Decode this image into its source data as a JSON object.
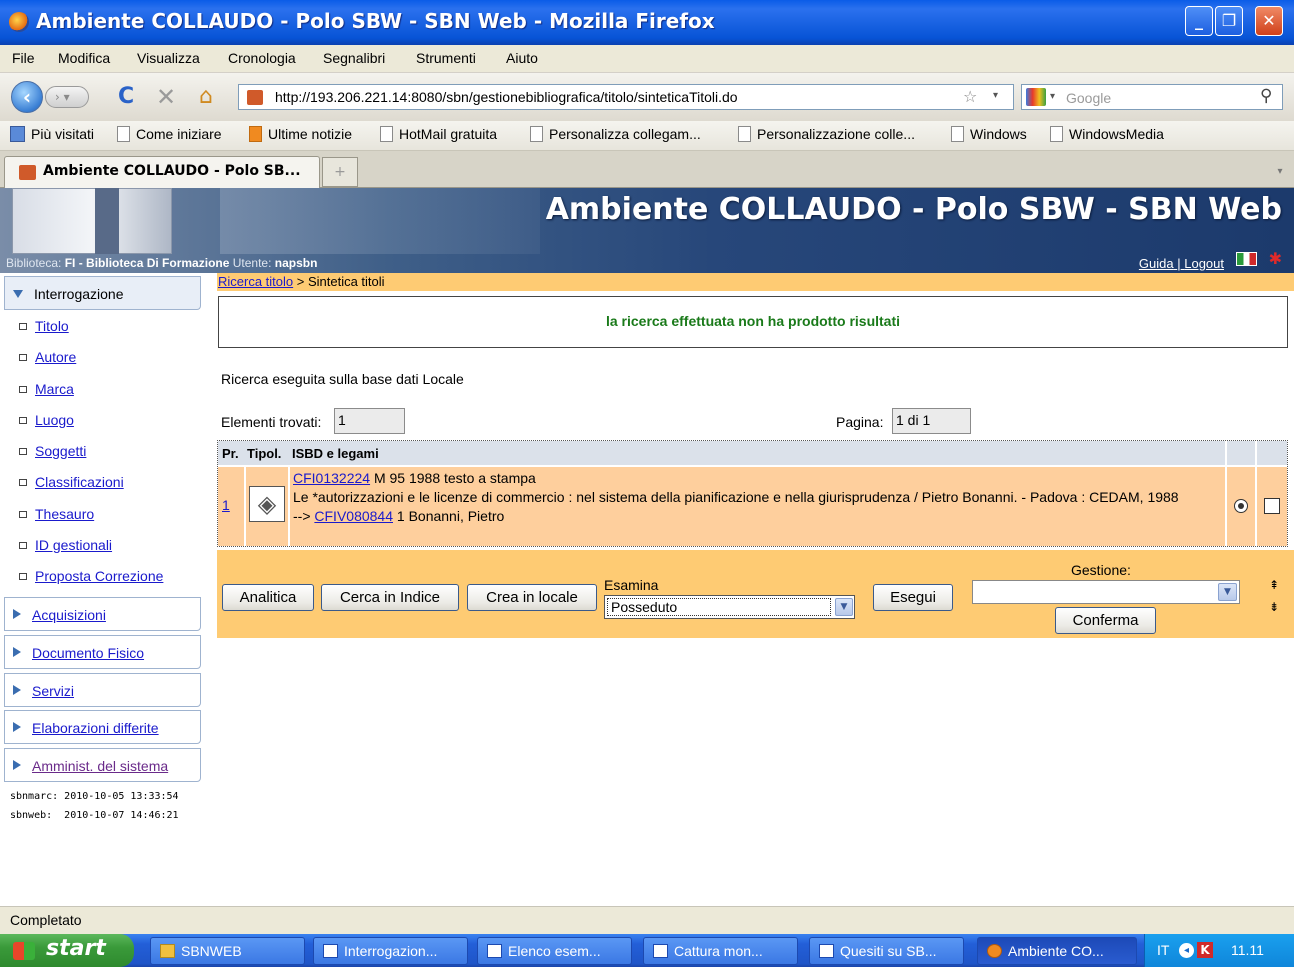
{
  "window": {
    "title": "Ambiente COLLAUDO - Polo SBW - SBN Web - Mozilla Firefox"
  },
  "menu": [
    "File",
    "Modifica",
    "Visualizza",
    "Cronologia",
    "Segnalibri",
    "Strumenti",
    "Aiuto"
  ],
  "nav": {
    "url": "http://193.206.221.14:8080/sbn/gestionebibliografica/titolo/sinteticaTitoli.do",
    "search_placeholder": "Google"
  },
  "bookmarks": [
    "Più visitati",
    "Come iniziare",
    "Ultime notizie",
    "HotMail gratuita",
    "Personalizza collegam...",
    "Personalizzazione colle...",
    "Windows",
    "WindowsMedia"
  ],
  "tab": {
    "label": "Ambiente COLLAUDO - Polo SB..."
  },
  "header": {
    "title": "Ambiente COLLAUDO - Polo SBW - SBN Web",
    "biblioteca_label": "Biblioteca:",
    "biblioteca_value": "FI - Biblioteca Di Formazione",
    "utente_label": "Utente:",
    "utente_value": "napsbn",
    "guida": "Guida",
    "sep": "|",
    "logout": "Logout"
  },
  "sidebar": {
    "section": "Interrogazione",
    "items": [
      "Titolo",
      "Autore",
      "Marca",
      "Luogo",
      "Soggetti",
      "Classificazioni",
      "Thesauro",
      "ID gestionali",
      "Proposta Correzione"
    ],
    "groups": [
      "Acquisizioni",
      "Documento Fisico",
      "Servizi",
      "Elaborazioni differite",
      "Amminist. del sistema"
    ],
    "sbnmarc": "sbnmarc: 2010-10-05 13:33:54",
    "sbnweb": "sbnweb:  2010-10-07 14:46:21"
  },
  "breadcrumb": {
    "link": "Ricerca titolo",
    "current": " > Sintetica titoli"
  },
  "message": "la ricerca effettuata non ha prodotto risultati",
  "search_info": "Ricerca eseguita sulla base dati Locale",
  "counts": {
    "found_label": "Elementi trovati:",
    "found_value": "1",
    "page_label": "Pagina:",
    "page_value": "1 di 1"
  },
  "table": {
    "headers": [
      "Pr.",
      "Tipol.",
      "ISBD e legami"
    ],
    "row": {
      "pr": "1",
      "id_link": "CFI0132224",
      "id_rest": " M 95 1988 testo a stampa",
      "desc": "Le *autorizzazioni e le licenze di commercio : nel sistema della pianificazione e nella giurisprudenza / Pietro Bonanni. - Padova : CEDAM, 1988",
      "arrow": "-->",
      "author_link": "CFIV080844",
      "author_rest": " 1 Bonanni, Pietro"
    }
  },
  "actions": {
    "analitica": "Analitica",
    "cerca": "Cerca in Indice",
    "crea": "Crea in locale",
    "esamina_label": "Esamina",
    "esamina_value": "Posseduto",
    "esegui": "Esegui",
    "gestione_label": "Gestione:",
    "gestione_value": "",
    "conferma": "Conferma"
  },
  "status": "Completato",
  "taskbar": {
    "start": "start",
    "items": [
      "SBNWEB",
      "Interrogazion...",
      "Elenco esem...",
      "Cattura mon...",
      "Quesiti su SB...",
      "Ambiente CO..."
    ],
    "lang": "IT",
    "clock": "11.11"
  }
}
